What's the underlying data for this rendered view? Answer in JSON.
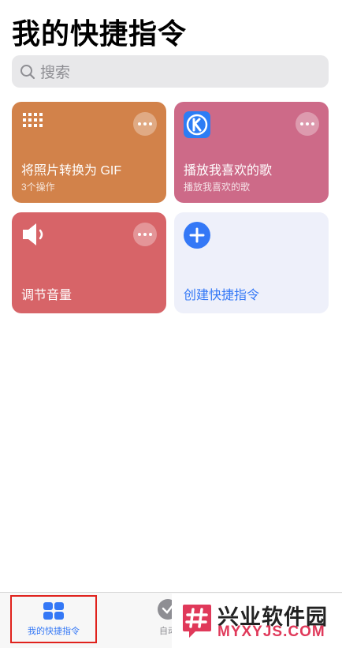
{
  "header": {
    "title": "我的快捷指令"
  },
  "search": {
    "placeholder": "搜索",
    "icon": "search-icon"
  },
  "shortcuts": [
    {
      "title": "将照片转换为 GIF",
      "subtitle": "3个操作",
      "color": "#d2824a",
      "icon": "grid-icon"
    },
    {
      "title": "播放我喜欢的歌",
      "subtitle": "播放我喜欢的歌",
      "color": "#cd6a88",
      "icon": "kugou-app-icon"
    },
    {
      "title": "调节音量",
      "color": "#d76468",
      "icon": "speaker-icon"
    }
  ],
  "create": {
    "label": "创建快捷指令",
    "color": "#3478f6"
  },
  "tabbar": {
    "mine_label": "我的快捷指令",
    "automation_label": "自动",
    "active_color": "#3478f6"
  },
  "watermark": {
    "name": "兴业软件园",
    "url": "MYXYJS.COM"
  }
}
